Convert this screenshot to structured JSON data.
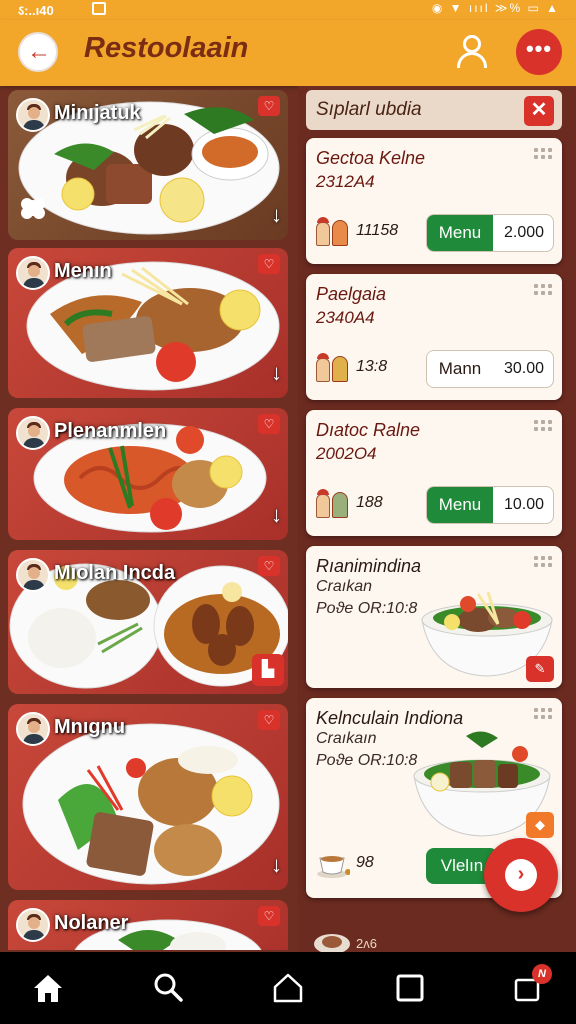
{
  "status_bar": {
    "time": "ऽ:..ı40",
    "right_text": "◉ ▼ ıııl ≫% ▭ ▲"
  },
  "app_bar": {
    "title": "Restoolaain"
  },
  "dishes": [
    {
      "name": "Minıjatuk"
    },
    {
      "name": "Menın"
    },
    {
      "name": "Plenanmlen"
    },
    {
      "name": "Mıolan Incda"
    },
    {
      "name": "Mnıgnu"
    },
    {
      "name": "Nolaner"
    }
  ],
  "panel": {
    "title": "Sıplarl ubdia"
  },
  "orders": [
    {
      "title": "Gectoa Kelne",
      "code": "2312A4",
      "qty": "11158",
      "button": "Menu",
      "price": "2.000"
    },
    {
      "title": "Paelgaia",
      "code": "2340A4",
      "qty": "13:8",
      "button": "Mann",
      "price": "30.00"
    },
    {
      "title": "Dıatoc Ralne",
      "code": "2002O4",
      "qty": "188",
      "button": "Menu",
      "price": "10.00"
    },
    {
      "title": "Rıanimindina",
      "sub1": "Craıkan",
      "sub2": "Poϑe OR:10:8"
    },
    {
      "title": "Kelnculain Indiona",
      "sub1": "Craıkaın",
      "sub2": "Poϑe OR:10:8",
      "qty": "98",
      "button": "Vlelın"
    }
  ],
  "peek": {
    "text": "2ᴧ6"
  },
  "nav_badge": "N",
  "colors": {
    "accent": "#f2a62a",
    "primary_red": "#d8322a",
    "green": "#1f8a3a",
    "background": "#6e2f22"
  }
}
